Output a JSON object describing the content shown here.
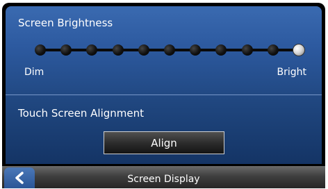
{
  "brightness": {
    "heading": "Screen Brightness",
    "min_label": "Dim",
    "max_label": "Bright",
    "steps": 11,
    "level": 10
  },
  "alignment": {
    "heading": "Touch Screen Alignment",
    "button_label": "Align"
  },
  "bottombar": {
    "title": "Screen Display",
    "back_icon": "chevron-left-icon"
  },
  "colors": {
    "panel_top": "#3a6ab0",
    "panel_bottom": "#143465",
    "bar": "#3f3f3f",
    "back_button": "#2a5596"
  }
}
